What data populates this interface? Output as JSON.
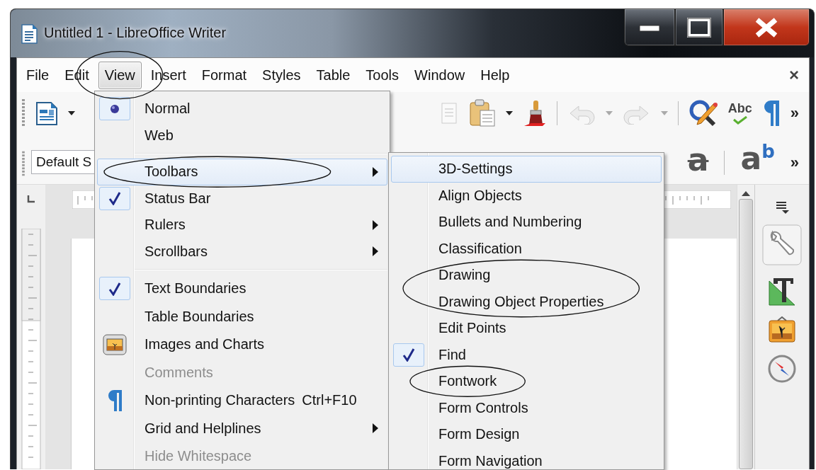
{
  "window": {
    "title": "Untitled 1 - LibreOffice Writer"
  },
  "menu_bar": {
    "items": [
      {
        "label": "File",
        "selected": false,
        "circled": false
      },
      {
        "label": "Edit",
        "selected": false,
        "circled": false
      },
      {
        "label": "View",
        "selected": true,
        "circled": true
      },
      {
        "label": "Insert",
        "selected": false,
        "circled": false
      },
      {
        "label": "Format",
        "selected": false,
        "circled": false
      },
      {
        "label": "Styles",
        "selected": false,
        "circled": false
      },
      {
        "label": "Table",
        "selected": false,
        "circled": false
      },
      {
        "label": "Tools",
        "selected": false,
        "circled": false
      },
      {
        "label": "Window",
        "selected": false,
        "circled": false
      },
      {
        "label": "Help",
        "selected": false,
        "circled": false
      }
    ],
    "close": "×"
  },
  "standard_toolbar": {
    "spelling_label": "Abc",
    "overflow": "»"
  },
  "formatting_toolbar": {
    "paragraph_style": "Default S",
    "fontwork_glyph": "a",
    "superscript_glyph": "a$^{b}$",
    "overflow": "»"
  },
  "view_menu": {
    "groups": [
      {
        "items": [
          {
            "label": "Normal",
            "kind": "radio",
            "checked": true,
            "selected": false,
            "disabled": false,
            "submenu": false,
            "circled": false
          },
          {
            "label": "Web",
            "kind": "radio",
            "checked": false,
            "selected": false,
            "disabled": false,
            "submenu": false,
            "circled": false
          }
        ]
      },
      {
        "items": [
          {
            "label": "Toolbars",
            "kind": "check",
            "checked": false,
            "selected": true,
            "disabled": false,
            "submenu": true,
            "circled": true
          },
          {
            "label": "Status Bar",
            "kind": "check",
            "checked": true,
            "selected": false,
            "disabled": false,
            "submenu": false,
            "circled": false
          },
          {
            "label": "Rulers",
            "kind": "check",
            "checked": false,
            "selected": false,
            "disabled": false,
            "submenu": true,
            "circled": false
          },
          {
            "label": "Scrollbars",
            "kind": "check",
            "checked": false,
            "selected": false,
            "disabled": false,
            "submenu": true,
            "circled": false
          }
        ]
      },
      {
        "items": [
          {
            "label": "Text Boundaries",
            "kind": "check",
            "checked": true,
            "selected": false,
            "disabled": false,
            "submenu": false,
            "circled": false
          },
          {
            "label": "Table Boundaries",
            "kind": "check",
            "checked": false,
            "selected": false,
            "disabled": false,
            "submenu": false,
            "circled": false
          },
          {
            "label": "Images and Charts",
            "kind": "images",
            "checked": true,
            "selected": false,
            "disabled": false,
            "submenu": false,
            "circled": false
          },
          {
            "label": "Comments",
            "kind": "check",
            "checked": false,
            "selected": false,
            "disabled": true,
            "submenu": false,
            "circled": false
          },
          {
            "label": "Non-printing Characters",
            "kind": "marks",
            "checked": false,
            "selected": false,
            "disabled": false,
            "submenu": false,
            "circled": false,
            "shortcut": "Ctrl+F10"
          },
          {
            "label": "Grid and Helplines",
            "kind": "check",
            "checked": false,
            "selected": false,
            "disabled": false,
            "submenu": true,
            "circled": false
          },
          {
            "label": "Hide Whitespace",
            "kind": "check",
            "checked": false,
            "selected": false,
            "disabled": true,
            "submenu": false,
            "circled": false
          }
        ]
      }
    ]
  },
  "toolbars_submenu": {
    "groups": [
      {
        "items": [
          {
            "label": "3D-Settings",
            "kind": "check",
            "checked": false,
            "selected": true,
            "disabled": false,
            "submenu": false,
            "circled": false
          },
          {
            "label": "Align Objects",
            "kind": "check",
            "checked": false,
            "selected": false,
            "disabled": false,
            "submenu": false,
            "circled": false
          },
          {
            "label": "Bullets and Numbering",
            "kind": "check",
            "checked": false,
            "selected": false,
            "disabled": false,
            "submenu": false,
            "circled": false
          },
          {
            "label": "Classification",
            "kind": "check",
            "checked": false,
            "selected": false,
            "disabled": false,
            "submenu": false,
            "circled": false
          },
          {
            "label": "Drawing",
            "kind": "check",
            "checked": false,
            "selected": false,
            "disabled": false,
            "submenu": false,
            "circled": true
          },
          {
            "label": "Drawing Object Properties",
            "kind": "check",
            "checked": false,
            "selected": false,
            "disabled": false,
            "submenu": false,
            "circled": true
          },
          {
            "label": "Edit Points",
            "kind": "check",
            "checked": false,
            "selected": false,
            "disabled": false,
            "submenu": false,
            "circled": false
          },
          {
            "label": "Find",
            "kind": "check",
            "checked": true,
            "selected": false,
            "disabled": false,
            "submenu": false,
            "circled": false
          },
          {
            "label": "Fontwork",
            "kind": "check",
            "checked": false,
            "selected": false,
            "disabled": false,
            "submenu": false,
            "circled": true
          },
          {
            "label": "Form Controls",
            "kind": "check",
            "checked": false,
            "selected": false,
            "disabled": false,
            "submenu": false,
            "circled": false
          },
          {
            "label": "Form Design",
            "kind": "check",
            "checked": false,
            "selected": false,
            "disabled": false,
            "submenu": false,
            "circled": false
          },
          {
            "label": "Form Navigation",
            "kind": "check",
            "checked": false,
            "selected": false,
            "disabled": false,
            "submenu": false,
            "circled": false
          }
        ]
      }
    ]
  }
}
